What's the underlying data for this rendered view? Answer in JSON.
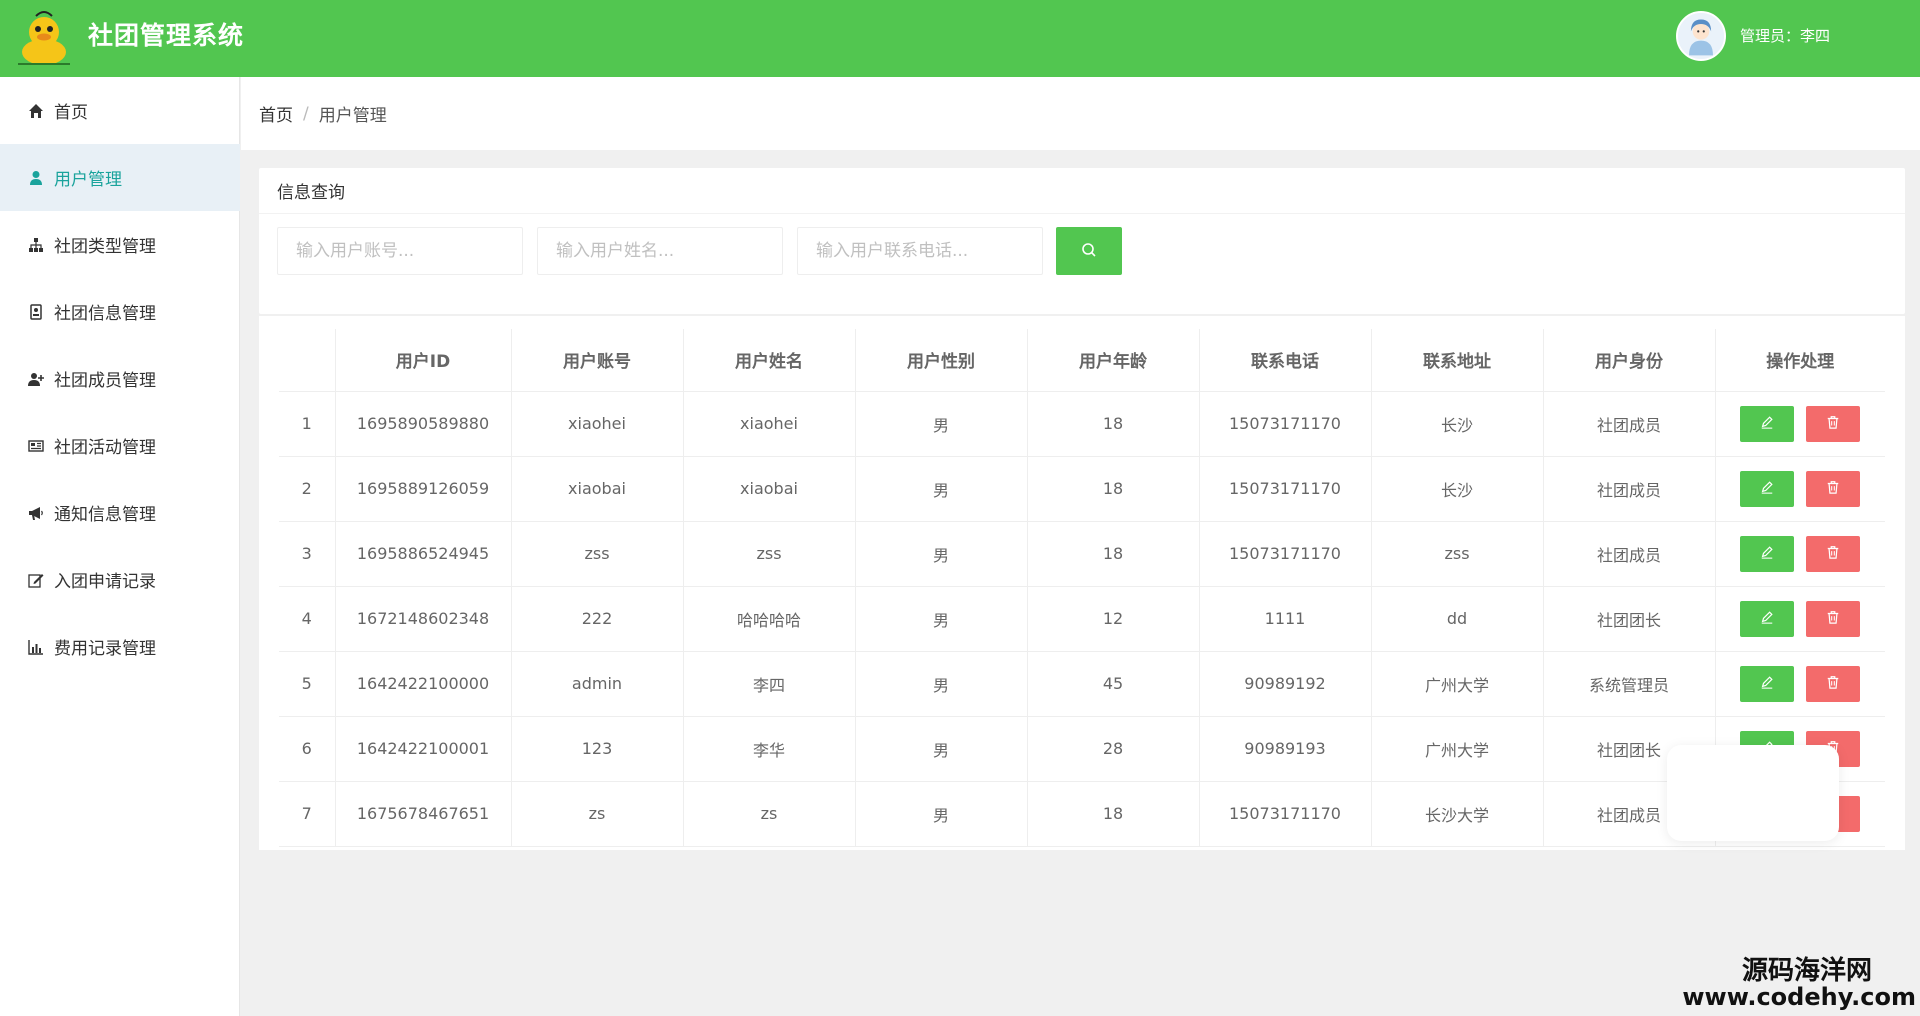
{
  "header": {
    "app_title": "社团管理系统",
    "admin_label": "管理员：李四",
    "brand_color": "#52c650"
  },
  "sidebar": {
    "items": [
      {
        "label": "首页",
        "icon": "home-icon",
        "active": false
      },
      {
        "label": "用户管理",
        "icon": "user-icon",
        "active": true
      },
      {
        "label": "社团类型管理",
        "icon": "sitemap-icon",
        "active": false
      },
      {
        "label": "社团信息管理",
        "icon": "id-card-icon",
        "active": false
      },
      {
        "label": "社团成员管理",
        "icon": "user-plus-icon",
        "active": false
      },
      {
        "label": "社团活动管理",
        "icon": "newspaper-icon",
        "active": false
      },
      {
        "label": "通知信息管理",
        "icon": "megaphone-icon",
        "active": false
      },
      {
        "label": "入团申请记录",
        "icon": "edit-icon",
        "active": false
      },
      {
        "label": "费用记录管理",
        "icon": "bar-chart-icon",
        "active": false
      }
    ]
  },
  "breadcrumb": {
    "home": "首页",
    "separator": "/",
    "current": "用户管理"
  },
  "search": {
    "title": "信息查询",
    "account_placeholder": "输入用户账号...",
    "name_placeholder": "输入用户姓名...",
    "phone_placeholder": "输入用户联系电话..."
  },
  "table": {
    "headers": [
      "",
      "用户ID",
      "用户账号",
      "用户姓名",
      "用户性别",
      "用户年龄",
      "联系电话",
      "联系地址",
      "用户身份",
      "操作处理"
    ],
    "rows": [
      {
        "no": "1",
        "id": "1695890589880",
        "account": "xiaohei",
        "name": "xiaohei",
        "gender": "男",
        "age": "18",
        "phone": "15073171170",
        "address": "长沙",
        "role": "社团成员"
      },
      {
        "no": "2",
        "id": "1695889126059",
        "account": "xiaobai",
        "name": "xiaobai",
        "gender": "男",
        "age": "18",
        "phone": "15073171170",
        "address": "长沙",
        "role": "社团成员"
      },
      {
        "no": "3",
        "id": "1695886524945",
        "account": "zss",
        "name": "zss",
        "gender": "男",
        "age": "18",
        "phone": "15073171170",
        "address": "zss",
        "role": "社团成员"
      },
      {
        "no": "4",
        "id": "1672148602348",
        "account": "222",
        "name": "哈哈哈哈",
        "gender": "男",
        "age": "12",
        "phone": "1111",
        "address": "dd",
        "role": "社团团长"
      },
      {
        "no": "5",
        "id": "1642422100000",
        "account": "admin",
        "name": "李四",
        "gender": "男",
        "age": "45",
        "phone": "90989192",
        "address": "广州大学",
        "role": "系统管理员"
      },
      {
        "no": "6",
        "id": "1642422100001",
        "account": "123",
        "name": "李华",
        "gender": "男",
        "age": "28",
        "phone": "90989193",
        "address": "广州大学",
        "role": "社团团长"
      },
      {
        "no": "7",
        "id": "1675678467651",
        "account": "zs",
        "name": "zs",
        "gender": "男",
        "age": "18",
        "phone": "15073171170",
        "address": "长沙大学",
        "role": "社团成员"
      }
    ]
  },
  "watermark": {
    "line1": "源码海洋网",
    "line2": "www.codehy.com"
  }
}
